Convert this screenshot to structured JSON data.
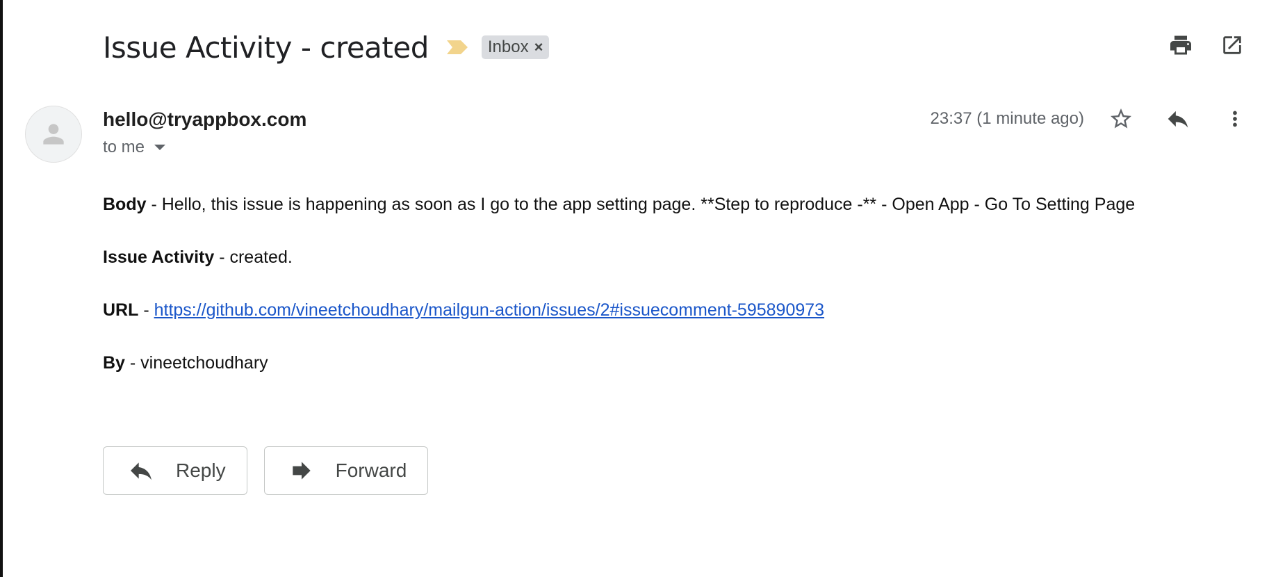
{
  "email": {
    "subject": "Issue Activity - created",
    "label": "Inbox",
    "label_remove": "×",
    "sender": "hello@tryappbox.com",
    "recipient": "to me",
    "timestamp": "23:37 (1 minute ago)"
  },
  "body": {
    "body_label": "Body",
    "body_text": " - Hello, this issue is happening as soon as I go to the app setting page. **Step to reproduce -** - Open App - Go To Setting Page",
    "activity_label": "Issue Activity",
    "activity_text": " - created.",
    "url_label": "URL",
    "url_sep": " - ",
    "url": "https://github.com/vineetchoudhary/mailgun-action/issues/2#issuecomment-595890973",
    "by_label": "By",
    "by_text": " - vineetchoudhary"
  },
  "actions": {
    "reply_label": "Reply",
    "forward_label": "Forward"
  },
  "icons": {
    "print": "print-icon",
    "open_new_window": "open-in-new-window-icon",
    "star": "star-icon",
    "reply": "reply-icon",
    "more": "more-vert-icon",
    "importance": "importance-marker-icon",
    "avatar": "person-icon",
    "forward": "forward-icon"
  },
  "colors": {
    "importance": "#f2d48c",
    "link": "#1a56c9",
    "chip_bg": "#dadce0"
  }
}
